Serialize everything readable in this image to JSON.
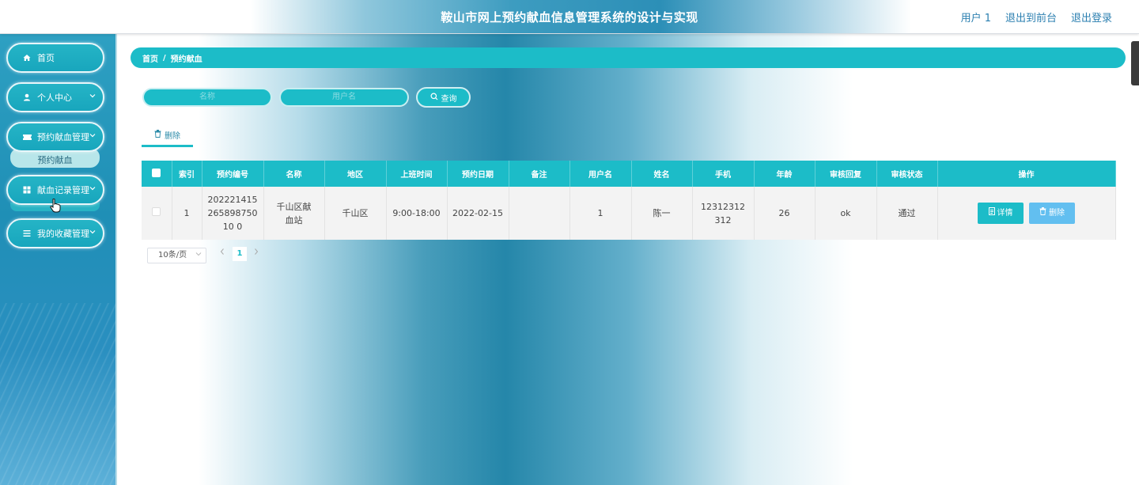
{
  "header": {
    "title": "鞍山市网上预约献血信息管理系统的设计与实现",
    "links": [
      "用户 1",
      "退出到前台",
      "退出登录"
    ]
  },
  "sidebar": {
    "items": [
      {
        "label": "首页",
        "icon": "home-icon",
        "has_chevron": false
      },
      {
        "label": "个人中心",
        "icon": "user-icon",
        "has_chevron": true
      },
      {
        "label": "预约献血管理",
        "icon": "ticket-icon",
        "has_chevron": true
      },
      {
        "label": "献血记录管理",
        "icon": "grid-icon",
        "has_chevron": true
      },
      {
        "label": "我的收藏管理",
        "icon": "list-icon",
        "has_chevron": true
      }
    ],
    "submenu": {
      "label": "预约献血"
    }
  },
  "breadcrumb": {
    "home": "首页",
    "separator": "/",
    "current": "预约献血"
  },
  "search": {
    "name_placeholder": "名称",
    "username_placeholder": "用户名",
    "button_label": "查询"
  },
  "toolbar": {
    "delete_label": "删除"
  },
  "table": {
    "columns": [
      "索引",
      "预约编号",
      "名称",
      "地区",
      "上班时间",
      "预约日期",
      "备注",
      "用户名",
      "姓名",
      "手机",
      "年龄",
      "审核回复",
      "审核状态",
      "操作"
    ],
    "rows": [
      {
        "index": "1",
        "booking_no": "20222141526589875010 0",
        "name": "千山区献血站",
        "region": "千山区",
        "hours": "9:00-18:00",
        "date": "2022-02-15",
        "note": "",
        "username": "1",
        "realname": "陈一",
        "phone": "12312312312",
        "age": "26",
        "reply": "ok",
        "status": "通过",
        "detail_label": "详情",
        "delete_label": "删除"
      }
    ]
  },
  "pagination": {
    "page_size": "10条/页",
    "current_page": "1"
  },
  "colors": {
    "accent": "#1cbcc8",
    "delete_button": "#62bff0",
    "sidebar": "#1f8fb6"
  }
}
